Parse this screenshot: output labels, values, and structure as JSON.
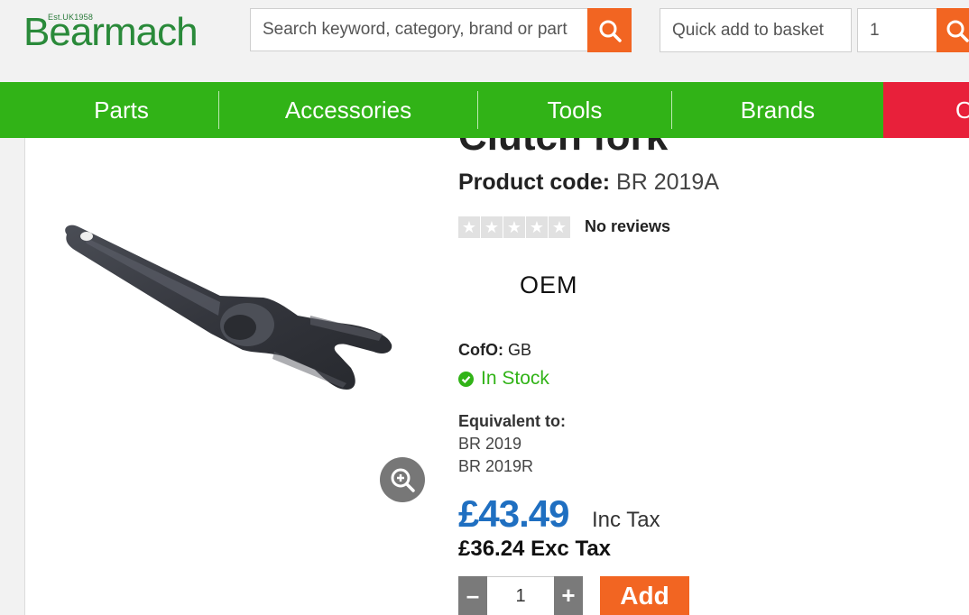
{
  "header": {
    "logo_text": "Bearmach",
    "logo_est": "Est.UK1958",
    "search_placeholder": "Search keyword, category, brand or part",
    "quick_add_placeholder": "Quick add to basket",
    "quick_add_qty": "1",
    "search_icon": "search-icon"
  },
  "nav": {
    "items": [
      {
        "label": "Parts"
      },
      {
        "label": "Accessories"
      },
      {
        "label": "Tools"
      },
      {
        "label": "Brands"
      }
    ],
    "offers_label": "O"
  },
  "product": {
    "title": "Clutch fork",
    "code_label": "Product code:",
    "code_value": "BR 2019A",
    "reviews": "No reviews",
    "rating": 0,
    "rating_max": 5,
    "badge": "OEM",
    "cofo_label": "CofO:",
    "cofo_value": "GB",
    "stock": "In Stock",
    "equivalent_label": "Equivalent to:",
    "equivalents": [
      "BR 2019",
      "BR 2019R"
    ],
    "price_inc": "£43.49",
    "price_inc_label": "Inc Tax",
    "price_exc": "£36.24 Exc Tax",
    "quantity": "1",
    "minus_label": "–",
    "plus_label": "+",
    "add_label": "Add"
  },
  "colors": {
    "brand_green": "#31b317",
    "accent_orange": "#f26522",
    "price_blue": "#1f6fc1",
    "offers_red": "#e8203a"
  }
}
